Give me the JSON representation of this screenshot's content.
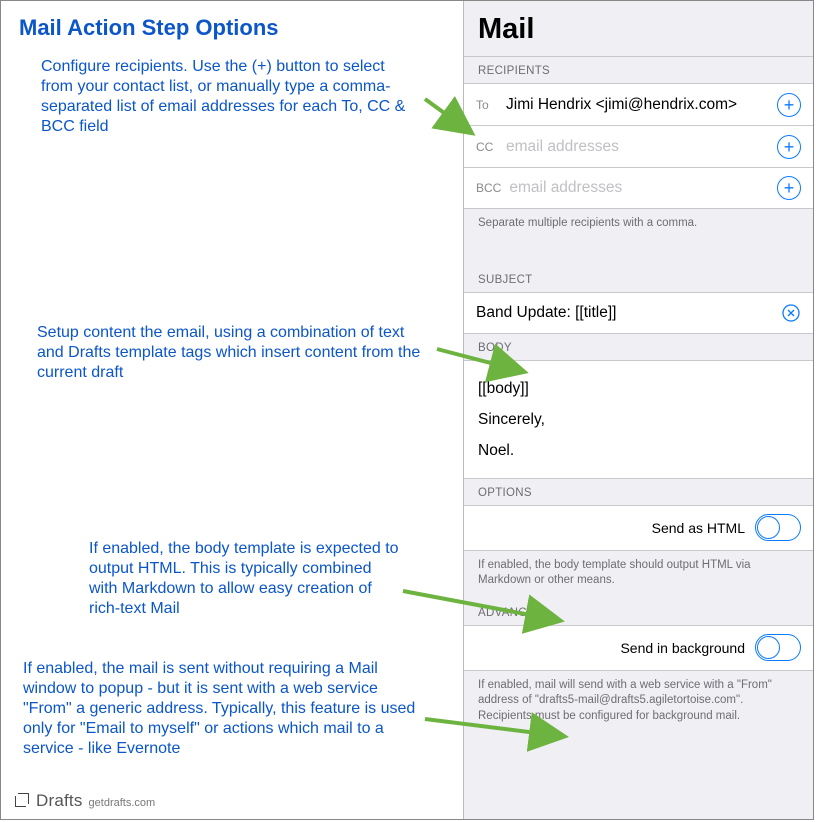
{
  "left": {
    "title": "Mail Action Step Options",
    "callouts": {
      "recipients": "Configure recipients. Use the (+) button to select from your contact list, or manually type a comma-separated list of email addresses for each To, CC & BCC field",
      "content": "Setup content the email, using a combination of text and Drafts template tags which insert content from the current draft",
      "html": "If enabled, the body template is expected to output HTML. This is typically combined with Markdown to allow easy creation of rich-text Mail",
      "background": "If enabled, the mail is sent without requiring a Mail window to popup - but it is sent with a web service \"From\" a generic address. Typically, this feature is used only for \"Email to myself\" or actions which mail to a service - like Evernote"
    },
    "footer": {
      "brand": "Drafts",
      "url": "getdrafts.com"
    }
  },
  "right": {
    "title": "Mail",
    "sections": {
      "recipients": {
        "label": "RECIPIENTS",
        "to": {
          "prefix": "To",
          "value": "Jimi Hendrix <jimi@hendrix.com>"
        },
        "cc": {
          "prefix": "CC",
          "placeholder": "email addresses"
        },
        "bcc": {
          "prefix": "BCC",
          "placeholder": "email addresses"
        },
        "hint": "Separate multiple recipients with a comma."
      },
      "subject": {
        "label": "SUBJECT",
        "value": "Band Update: [[title]]"
      },
      "body": {
        "label": "BODY",
        "value": "[[body]]\nSincerely,\nNoel."
      },
      "options": {
        "label": "OPTIONS",
        "html_label": "Send as HTML",
        "html_hint": "If enabled, the body template should output HTML via Markdown or other means."
      },
      "advanced": {
        "label": "ADVANCED",
        "bg_label": "Send in background",
        "bg_hint": "If enabled, mail will send with a web service with a \"From\" address of \"drafts5-mail@drafts5.agiletortoise.com\". Recipients must be configured for background mail."
      }
    }
  }
}
